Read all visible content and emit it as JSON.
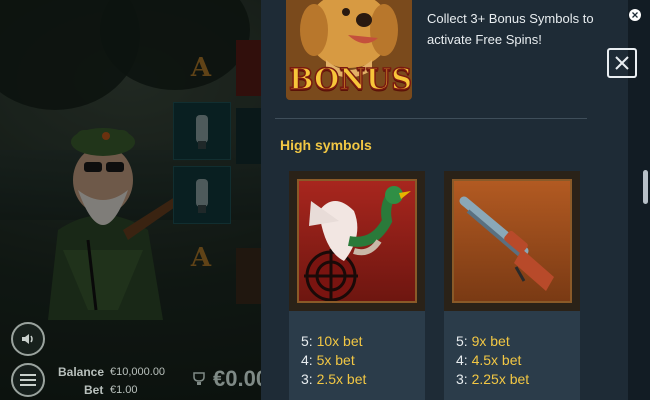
{
  "game": {
    "reel_letter": "A",
    "balance_label": "Balance",
    "balance_value": "€10,000.00",
    "bet_label": "Bet",
    "bet_value": "€1.00",
    "win_value": "€0.00"
  },
  "paytable": {
    "bonus": {
      "card_text": "BONUS",
      "description": "Collect 3+ Bonus Symbols to activate Free Spins!"
    },
    "high_symbols_title": "High symbols",
    "symbols": [
      {
        "name": "mallard-duck",
        "pays": [
          {
            "count": "5:",
            "value": "10x bet"
          },
          {
            "count": "4:",
            "value": "5x bet"
          },
          {
            "count": "3:",
            "value": "2.5x bet"
          }
        ]
      },
      {
        "name": "shotgun",
        "pays": [
          {
            "count": "5:",
            "value": "9x bet"
          },
          {
            "count": "4:",
            "value": "4.5x bet"
          },
          {
            "count": "3:",
            "value": "2.25x bet"
          }
        ]
      }
    ]
  },
  "colors": {
    "accent": "#f2c744",
    "panel": "#1e2b36",
    "card": "#2b3c4a"
  }
}
